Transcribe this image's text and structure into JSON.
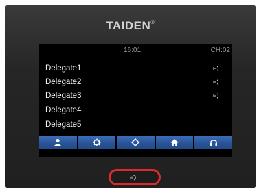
{
  "device": {
    "brand": "TAIDEN",
    "brand_mark": "®"
  },
  "screen": {
    "time": "16:01",
    "channel": "CH:02",
    "delegates": [
      {
        "name": "Delegate1",
        "speaking": true
      },
      {
        "name": "Delegate2",
        "speaking": true
      },
      {
        "name": "Delegate3",
        "speaking": true
      },
      {
        "name": "Delegate4",
        "speaking": false
      },
      {
        "name": "Delegate5",
        "speaking": false
      }
    ]
  },
  "tabs": [
    {
      "icon": "person-icon"
    },
    {
      "icon": "gear-icon"
    },
    {
      "icon": "diamond-icon"
    },
    {
      "icon": "home-icon"
    },
    {
      "icon": "headphones-icon"
    }
  ],
  "speak_button": {
    "icon": "microphone-icon"
  },
  "colors": {
    "accent_blue": "#2a5498",
    "highlight_red": "#e02a2a",
    "body": "#262626",
    "screen": "#000000"
  }
}
